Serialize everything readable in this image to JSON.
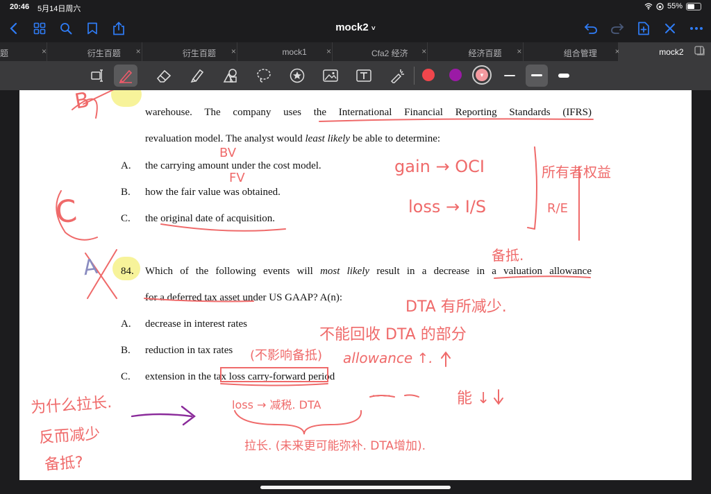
{
  "status": {
    "time": "20:46",
    "date": "5月14日周六",
    "battery": "55%",
    "battery_level": 0.55
  },
  "nav": {
    "title": "mock2",
    "title_chevron": "˅"
  },
  "tabs": [
    {
      "label": "题",
      "active": false
    },
    {
      "label": "衍生百题",
      "active": false
    },
    {
      "label": "衍生百题",
      "active": false
    },
    {
      "label": "mock1",
      "active": false
    },
    {
      "label": "Cfa2 经济",
      "active": false
    },
    {
      "label": "经济百题",
      "active": false
    },
    {
      "label": "组合管理",
      "active": false
    },
    {
      "label": "mock2",
      "active": true
    }
  ],
  "colors": {
    "accent": "#2f7cf6",
    "annotation_red": "#ef6a6a",
    "annotation_purple": "#8a2a9a",
    "highlight": "#f7f39a",
    "swatch_red": "#f0464c",
    "swatch_purple": "#9b1aa6",
    "swatch_pink": "#f49aa0"
  },
  "toolbar": {
    "tools": [
      "text-select-icon",
      "pen-icon",
      "eraser-icon",
      "highlighter-icon",
      "shapes-icon",
      "lasso-icon",
      "sticker-icon",
      "image-icon",
      "textbox-icon",
      "laser-pointer-icon"
    ]
  },
  "doc": {
    "q83": {
      "line1": "warehouse.  The  company  uses  the  International  Financial  Reporting  Standards  (IFRS)",
      "line2_pre": "revaluation model. The analyst would ",
      "line2_em": "least likely",
      "line2_post": " be able to determine:",
      "options": [
        {
          "letter": "A.",
          "text": "the carrying amount under the cost model."
        },
        {
          "letter": "B.",
          "text": "how the fair value was obtained."
        },
        {
          "letter": "C.",
          "text": "the original date of acquisition."
        }
      ]
    },
    "q84": {
      "number": "84.",
      "line1_pre": "Which of the following events will ",
      "line1_em": "most likely",
      "line1_post": " result in a decrease in a valuation allowance",
      "line2": "for a deferred tax asset under US GAAP? A(n):",
      "options": [
        {
          "letter": "A.",
          "text": "decrease in interest rates"
        },
        {
          "letter": "B.",
          "text": "reduction in tax rates"
        },
        {
          "letter": "C.",
          "text": "extension in the tax loss carry-forward period"
        }
      ]
    }
  },
  "annotations": {
    "mark_b": "B",
    "mark_c": "C",
    "mark_a": "A",
    "bv": "BV",
    "fv": "FV",
    "gain": "gain → OCI",
    "loss": "loss → I/S",
    "note_right_1": "所有者权益",
    "note_right_2": "R/E",
    "note_allowance": "备抵.",
    "note_dta": "DTA 有所减少.",
    "note_recover": "不能回收 DTA 的部分",
    "note_allowance_up": "allowance ↑.",
    "note_reduce": "(不影响备抵)",
    "note_loss": "loss → 减税. DTA",
    "note_ldots": "‿‿",
    "note_neng": "能 ↓",
    "note_extend": "拉长. (未来更可能弥补. DTA增加).",
    "note_left_1": "为什么拉长.",
    "note_left_2": "反而减少",
    "note_left_3": "备抵?"
  }
}
